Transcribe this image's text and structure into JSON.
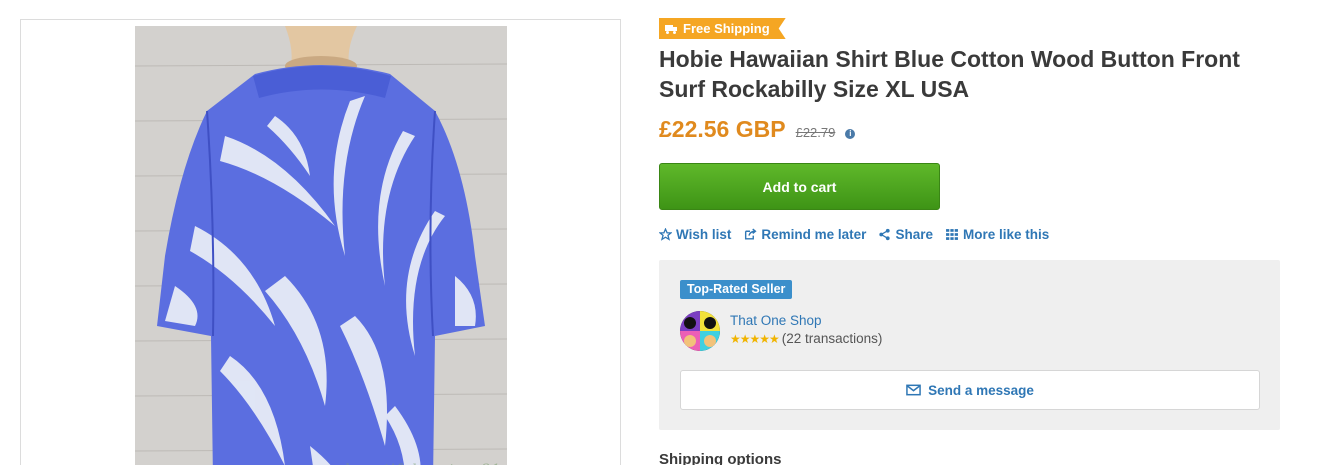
{
  "product": {
    "image_watermark": "beautifulmystery31",
    "free_shipping_label": "Free Shipping",
    "title": "Hobie Hawaiian Shirt Blue Cotton Wood Button Front Surf Rockabilly Size XL USA",
    "price": "£22.56 GBP",
    "original_price": "£22.79",
    "add_to_cart_label": "Add to cart"
  },
  "actions": [
    {
      "label": "Wish list",
      "icon": "star-outline-icon"
    },
    {
      "label": "Remind me later",
      "icon": "share-external-icon"
    },
    {
      "label": "Share",
      "icon": "share-nodes-icon"
    },
    {
      "label": "More like this",
      "icon": "grid-icon"
    }
  ],
  "seller": {
    "badge": "Top-Rated Seller",
    "name": "That One Shop",
    "rating_stars": 5,
    "transactions": "(22 transactions)",
    "message_button": "Send a message"
  },
  "shipping": {
    "heading": "Shipping options"
  },
  "colors": {
    "accent_link": "#2f77b5",
    "price": "#e08a1e",
    "cart_green": "#4ca621",
    "free_shipping": "#f5a623",
    "top_rated_badge": "#3b8fcb"
  }
}
